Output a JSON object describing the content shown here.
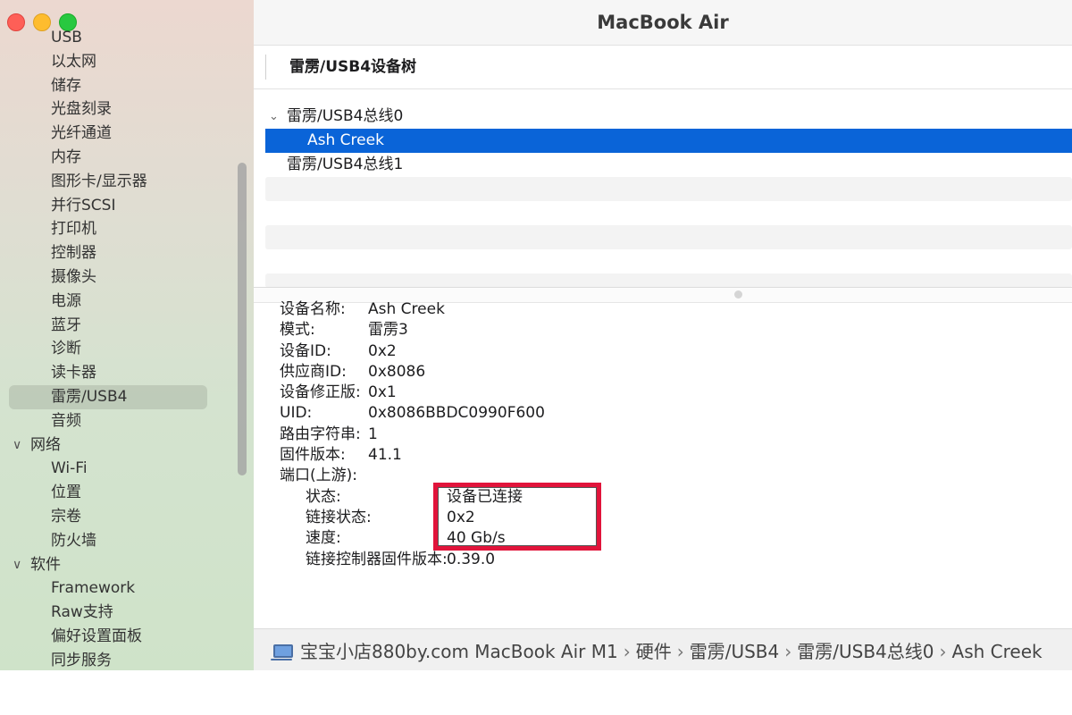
{
  "window": {
    "title": "MacBook Air"
  },
  "sidebar": {
    "items": [
      {
        "type": "item",
        "label": "USB"
      },
      {
        "type": "item",
        "label": "以太网"
      },
      {
        "type": "item",
        "label": "储存"
      },
      {
        "type": "item",
        "label": "光盘刻录"
      },
      {
        "type": "item",
        "label": "光纤通道"
      },
      {
        "type": "item",
        "label": "内存"
      },
      {
        "type": "item",
        "label": "图形卡/显示器"
      },
      {
        "type": "item",
        "label": "并行SCSI"
      },
      {
        "type": "item",
        "label": "打印机"
      },
      {
        "type": "item",
        "label": "控制器"
      },
      {
        "type": "item",
        "label": "摄像头"
      },
      {
        "type": "item",
        "label": "电源"
      },
      {
        "type": "item",
        "label": "蓝牙"
      },
      {
        "type": "item",
        "label": "诊断"
      },
      {
        "type": "item",
        "label": "读卡器"
      },
      {
        "type": "item",
        "label": "雷雳/USB4",
        "selected": true
      },
      {
        "type": "item",
        "label": "音频"
      },
      {
        "type": "section",
        "label": "网络"
      },
      {
        "type": "item",
        "label": "Wi-Fi"
      },
      {
        "type": "item",
        "label": "位置"
      },
      {
        "type": "item",
        "label": "宗卷"
      },
      {
        "type": "item",
        "label": "防火墙"
      },
      {
        "type": "section",
        "label": "软件"
      },
      {
        "type": "item",
        "label": "Framework"
      },
      {
        "type": "item",
        "label": "Raw支持"
      },
      {
        "type": "item",
        "label": "偏好设置面板"
      },
      {
        "type": "item",
        "label": "同步服务"
      }
    ]
  },
  "tree": {
    "header": "雷雳/USB4设备树",
    "rows": [
      {
        "label": "雷雳/USB4总线0",
        "level": 0,
        "expanded": true
      },
      {
        "label": "Ash Creek",
        "level": 1,
        "selected": true
      },
      {
        "label": "雷雳/USB4总线1",
        "level": 0
      }
    ]
  },
  "details": {
    "fields": [
      {
        "key": "设备名称:",
        "value": "Ash Creek"
      },
      {
        "key": "模式:",
        "value": "雷雳3"
      },
      {
        "key": "设备ID:",
        "value": "0x2"
      },
      {
        "key": "供应商ID:",
        "value": "0x8086"
      },
      {
        "key": "设备修正版:",
        "value": "0x1"
      },
      {
        "key": "UID:",
        "value": "0x8086BBDC0990F600"
      },
      {
        "key": "路由字符串:",
        "value": "1"
      },
      {
        "key": "固件版本:",
        "value": "41.1"
      },
      {
        "key": "端口(上游):",
        "value": ""
      }
    ],
    "port_fields": [
      {
        "key": "状态:",
        "value": "设备已连接"
      },
      {
        "key": "链接状态:",
        "value": "0x2"
      },
      {
        "key": "速度:",
        "value": "40 Gb/s"
      },
      {
        "key": "链接控制器固件版本:",
        "value": "0.39.0"
      }
    ]
  },
  "pathbar": {
    "icon": "laptop-icon",
    "crumbs": [
      "宝宝小店880by.com MacBook Air M1",
      "硬件",
      "雷雳/USB4",
      "雷雳/USB4总线0",
      "Ash Creek"
    ]
  },
  "colors": {
    "selection": "#0a64d8",
    "annotation": "#e1143b"
  }
}
